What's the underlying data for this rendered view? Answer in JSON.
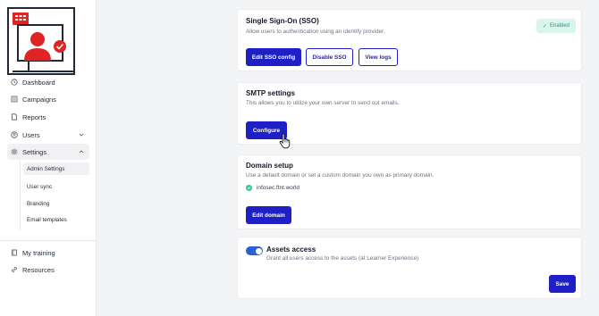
{
  "sidebar": {
    "items": [
      {
        "label": "Dashboard",
        "icon": "clock-icon"
      },
      {
        "label": "Campaigns",
        "icon": "list-icon"
      },
      {
        "label": "Reports",
        "icon": "document-icon"
      },
      {
        "label": "Users",
        "icon": "user-circle-icon"
      },
      {
        "label": "Settings",
        "icon": "gear-icon"
      }
    ],
    "sub_items": [
      {
        "label": "Admin Settings"
      },
      {
        "label": "User sync"
      },
      {
        "label": "Branding"
      },
      {
        "label": "Email templates"
      }
    ],
    "footer_items": [
      {
        "label": "My training",
        "icon": "book-icon"
      },
      {
        "label": "Resources",
        "icon": "link-icon"
      }
    ]
  },
  "sso": {
    "title": "Single Sign-On (SSO)",
    "description": "Allow users to authentication using an identify provider.",
    "badge": "Enabled",
    "edit_label": "Edit SSO config",
    "disable_label": "Disable SSO",
    "logs_label": "View logs"
  },
  "smtp": {
    "title": "SMTP settings",
    "description": "This allows you to utilize your own server to send out emails.",
    "configure_label": "Configure"
  },
  "domain": {
    "title": "Domain setup",
    "description": "Use a default domain or set a custom domain you own as primary domain.",
    "value": "infosec.ftnt.world",
    "edit_label": "Edit domain"
  },
  "assets": {
    "title": "Assets access",
    "description": "Grant all users access to the assets (at Learner Experience)",
    "enabled": true,
    "save_label": "Save"
  },
  "colors": {
    "primary": "#1e1fc4",
    "toggle": "#2a5fd6",
    "badge_bg": "#d8f5ee",
    "logo_red": "#e02424"
  }
}
